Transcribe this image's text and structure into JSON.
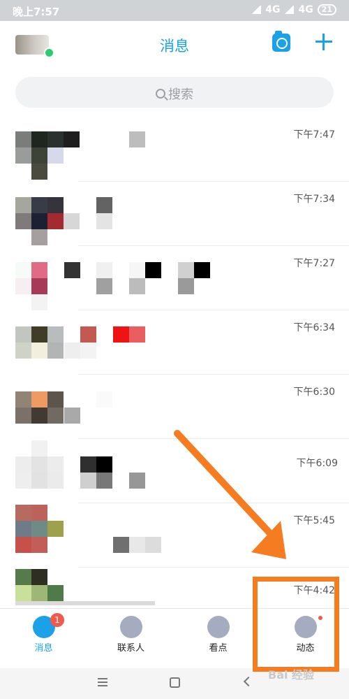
{
  "status_bar": {
    "time": "晚上7:57",
    "network_1": "4G",
    "network_2": "4G",
    "battery": "21"
  },
  "header": {
    "title": "消息"
  },
  "search": {
    "placeholder": "搜索"
  },
  "chats": [
    {
      "time": "下午7:47"
    },
    {
      "time": "下午7:34"
    },
    {
      "time": "下午7:27"
    },
    {
      "time": "下午6:34"
    },
    {
      "time": "下午6:30"
    },
    {
      "time": "下午6:09"
    },
    {
      "time": "下午5:45"
    },
    {
      "time": "下午4:42"
    }
  ],
  "tabbar": {
    "tabs": [
      {
        "label": "消息",
        "badge": "1",
        "icon": "message-icon",
        "color": "#1aa1e8"
      },
      {
        "label": "联系人",
        "icon": "contacts-icon",
        "color": "#a5acbf"
      },
      {
        "label": "看点",
        "icon": "eye-icon",
        "color": "#a5acbf"
      },
      {
        "label": "动态",
        "icon": "star-icon",
        "color": "#a5acbf"
      }
    ]
  },
  "watermark": "Bai 经验",
  "colors": {
    "accent": "#1aa1e8",
    "annotation": "#f57c20",
    "badge": "#f05a4d",
    "online": "#2ecc71"
  }
}
